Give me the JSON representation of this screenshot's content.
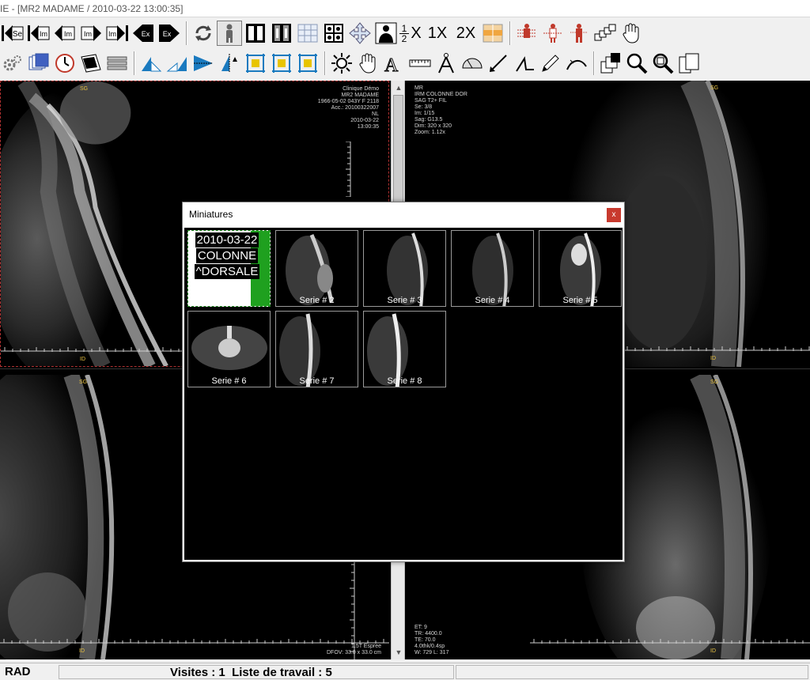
{
  "window": {
    "title": "IE - [MR2 MADAME / 2010-03-22 13:00:35]"
  },
  "toolbar": {
    "row1": [
      {
        "name": "series-first-icon",
        "label": "Se"
      },
      {
        "name": "image-first-icon",
        "label": "Im"
      },
      {
        "name": "image-prev-icon",
        "label": "Im"
      },
      {
        "name": "image-next-icon",
        "label": "Im"
      },
      {
        "name": "image-last-icon",
        "label": "Im"
      },
      {
        "name": "exam-prev-icon",
        "label": "Ex"
      },
      {
        "name": "exam-next-icon",
        "label": "Ex"
      }
    ],
    "zoom": {
      "fraction_top": "1",
      "fraction_bottom": "2",
      "half_suffix": "X",
      "one_x": "1X",
      "two_x": "2X"
    }
  },
  "viewports": {
    "top_left": {
      "info": [
        "Clinique Démo",
        "MR2 MADAME",
        "1966-05-02 043Y F 2118",
        "Acc.: 20100322007",
        "NL",
        "2010-03-22",
        "13:00:35"
      ],
      "orient_top": "SG",
      "orient_bottom": "ID"
    },
    "top_right": {
      "info": [
        "MR",
        "IRM COLONNE DOR",
        "SAG T2+  FIL",
        "Se: 3/8",
        "Im: 1/15",
        "Sag: G13.5",
        "Dim: 320 x 320",
        "Zoom: 1.12x"
      ],
      "orient_top": "SG",
      "orient_bottom": "ID"
    },
    "bottom_left": {
      "info": [
        "1.5T Espree",
        "DFOV: 33.0 x 33.0 cm"
      ],
      "orient_top": "SG",
      "orient_bottom": "ID"
    },
    "bottom_right": {
      "info": [
        "ET: 9",
        "TR: 4400.0",
        "TE: 70.0",
        "4.0thk/0.4sp",
        "W: 729 L: 317"
      ],
      "orient_top": "SG",
      "orient_bottom": "ID"
    }
  },
  "dialog": {
    "title": "Miniatures",
    "close": "x",
    "cover": [
      "2010-03-22",
      "COLONNE",
      "^DORSALE"
    ],
    "series": [
      "Serie # 2",
      "Serie # 3",
      "Serie # 4",
      "Serie # 5",
      "Serie # 6",
      "Serie # 7",
      "Serie # 8"
    ]
  },
  "statusbar": {
    "mode": "RAD",
    "summary": "Visites : 1  Liste de travail : 5"
  },
  "colors": {
    "accent_red": "#c83a2e",
    "accent_green": "#1fa01f",
    "toolbar_blue": "#1a7abf",
    "toolbar_yellow": "#e8c400",
    "overlay_yellow": "#e6c040"
  }
}
